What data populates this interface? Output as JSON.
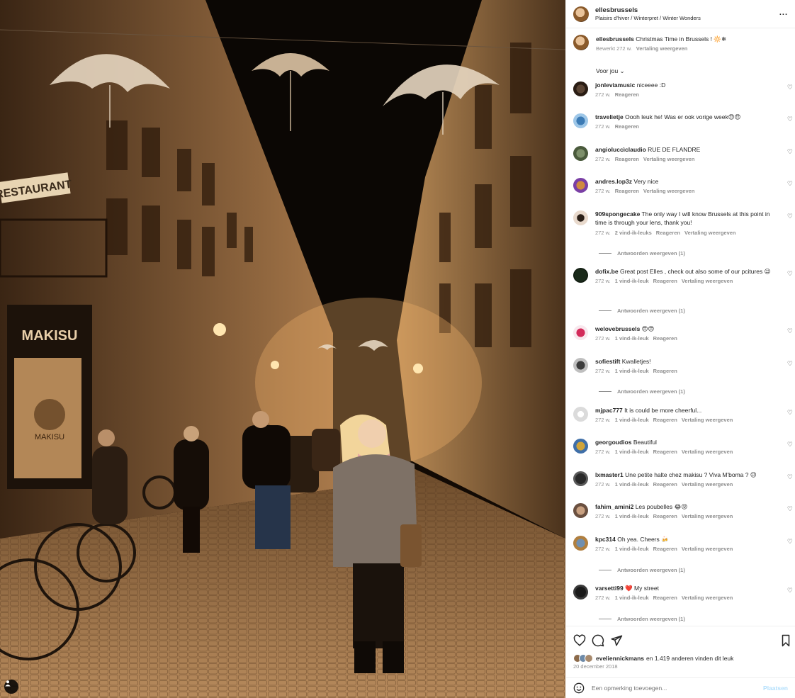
{
  "header": {
    "username": "ellesbrussels",
    "location": "Plaisirs d'hiver / Winterpret / Winter Wonders",
    "more": "..."
  },
  "caption": {
    "username": "ellesbrussels",
    "text": "Christmas Time in Brussels ! 🔆❄",
    "edited": "Bewerkt",
    "time": "272 w.",
    "translate": "Vertaling weergeven"
  },
  "sort_label": "Voor jou ⌄",
  "comments": [
    {
      "user": "jonleviamusic",
      "text": "niceeee :D",
      "time": "272 w.",
      "likes": "",
      "reply": "Reageren",
      "translate": "",
      "replies": ""
    },
    {
      "user": "travelietje",
      "text": "Oooh leuk he! Was er ook vorige week😍😍",
      "time": "272 w.",
      "likes": "",
      "reply": "Reageren",
      "translate": "",
      "replies": ""
    },
    {
      "user": "angioluccìclaudio",
      "text": "RUE DE FLANDRE",
      "time": "272 w.",
      "likes": "",
      "reply": "Reageren",
      "translate": "Vertaling weergeven",
      "replies": ""
    },
    {
      "user": "andres.lop3z",
      "text": "Very nice",
      "time": "272 w.",
      "likes": "",
      "reply": "Reageren",
      "translate": "Vertaling weergeven",
      "replies": ""
    },
    {
      "user": "909spongecake",
      "text": "The only way I will know Brussels at this point in time is through your lens, thank you!",
      "time": "272 w.",
      "likes": "2 vind-ik-leuks",
      "reply": "Reageren",
      "translate": "Vertaling weergeven",
      "replies": "Antwoorden weergeven (1)"
    },
    {
      "user": "dofix.be",
      "text": "Great post Elles , check out also some of our pcitures 😉",
      "time": "272 w.",
      "likes": "1 vind-ik-leuk",
      "reply": "Reageren",
      "translate": "Vertaling weergeven",
      "replies": "Antwoorden weergeven (1)"
    },
    {
      "user": "welovebrussels",
      "text": "😍😍",
      "time": "272 w.",
      "likes": "1 vind-ik-leuk",
      "reply": "Reageren",
      "translate": "",
      "replies": ""
    },
    {
      "user": "sofiestift",
      "text": "Kwalletjes!",
      "time": "272 w.",
      "likes": "1 vind-ik-leuk",
      "reply": "Reageren",
      "translate": "",
      "replies": "Antwoorden weergeven (1)"
    },
    {
      "user": "mjpac777",
      "text": "It is could be more cheerful...",
      "time": "272 w.",
      "likes": "1 vind-ik-leuk",
      "reply": "Reageren",
      "translate": "Vertaling weergeven",
      "replies": ""
    },
    {
      "user": "georgoudios",
      "text": "Beautiful",
      "time": "272 w.",
      "likes": "1 vind-ik-leuk",
      "reply": "Reageren",
      "translate": "Vertaling weergeven",
      "replies": ""
    },
    {
      "user": "lxmaster1",
      "text": "Une petite halte chez makisu ? Viva M'boma ? 😉",
      "time": "272 w.",
      "likes": "1 vind-ik-leuk",
      "reply": "Reageren",
      "translate": "Vertaling weergeven",
      "replies": ""
    },
    {
      "user": "fahim_amini2",
      "text": "Les poubelles 😂😜",
      "time": "272 w.",
      "likes": "1 vind-ik-leuk",
      "reply": "Reageren",
      "translate": "Vertaling weergeven",
      "replies": ""
    },
    {
      "user": "kpc314",
      "text": "Oh yea. Cheers 🍻",
      "time": "272 w.",
      "likes": "1 vind-ik-leuk",
      "reply": "Reageren",
      "translate": "Vertaling weergeven",
      "replies": "Antwoorden weergeven (1)"
    },
    {
      "user": "varsetti99",
      "text": "❤️ My street",
      "time": "272 w.",
      "likes": "1 vind-ik-leuk",
      "reply": "Reageren",
      "translate": "Vertaling weergeven",
      "replies": "Antwoorden weergeven (1)"
    }
  ],
  "likes_line": {
    "user": "eveliennickmans",
    "rest": "en 1.419 anderen vinden dit leuk"
  },
  "date": "20 december 2018",
  "add_comment": {
    "placeholder": "Een opmerking toevoegen...",
    "post": "Plaatsen"
  },
  "photo_signs": {
    "restaurant": "RESTAURANT",
    "shop": "MAKISU",
    "shop_small": "MAKISU"
  },
  "colors": {
    "accent_blue": "#b2dffc",
    "text": "#262626",
    "muted": "#8e8e8e",
    "heart_red": "#e0245e"
  }
}
